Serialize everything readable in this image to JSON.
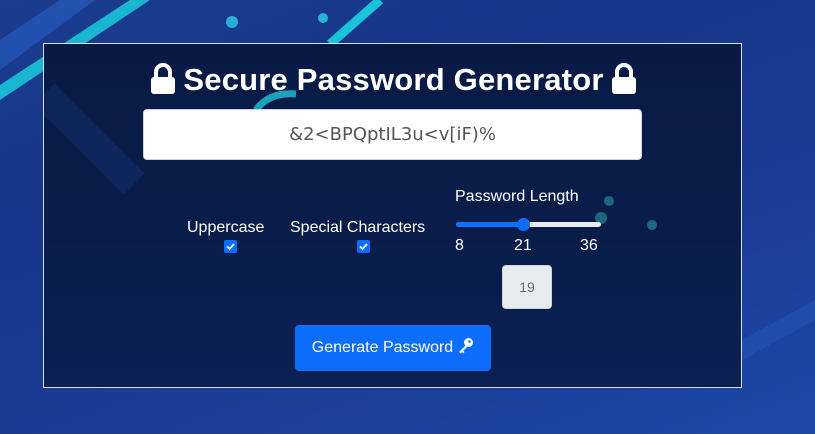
{
  "title": "Secure Password Generator",
  "title_icon": "lock-icon",
  "password": "&2<BPQptIL3u<v[iF)%",
  "options": {
    "uppercase_label": "Uppercase",
    "uppercase_checked": true,
    "special_label": "Special Characters",
    "special_checked": true
  },
  "length": {
    "label": "Password Length",
    "min": "8",
    "current": "21",
    "max": "36",
    "slider_value": 21,
    "input_value": "19"
  },
  "generate_button": {
    "label": "Generate Password",
    "icon": "key-icon"
  },
  "colors": {
    "accent": "#0d6efd",
    "panel_bg": "#0a1d4a",
    "page_bg": "#1a3d8f"
  }
}
